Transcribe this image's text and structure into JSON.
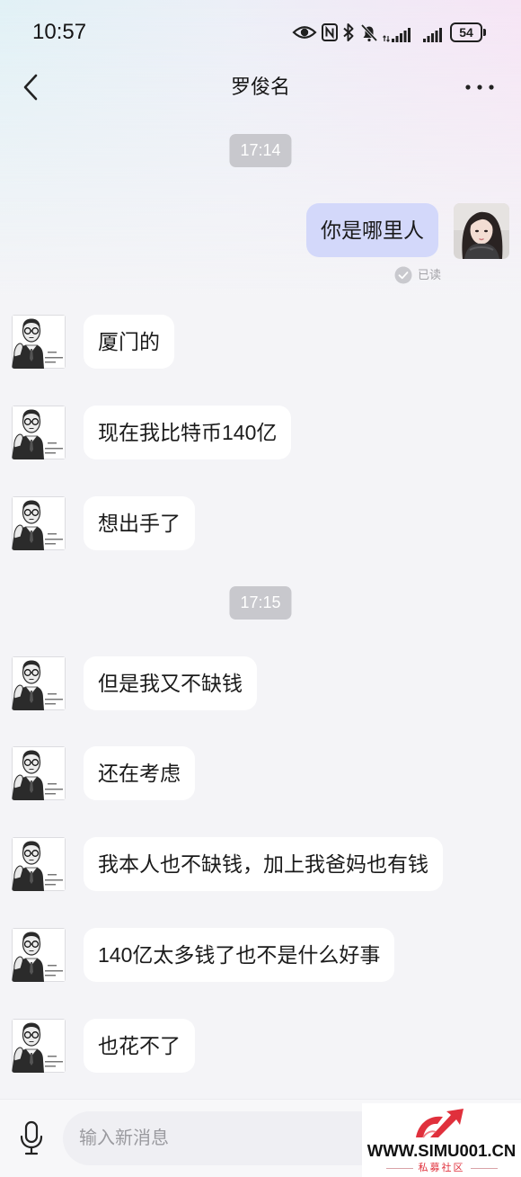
{
  "status_bar": {
    "time": "10:57",
    "battery": "54",
    "icons": [
      "eye-icon",
      "nfc-icon",
      "bluetooth-icon",
      "mute-bell-icon",
      "signal-icon",
      "signal-icon",
      "battery-icon"
    ]
  },
  "header": {
    "title": "罗俊名",
    "back_icon": "back-chevron-icon",
    "menu_icon": "more-dots-icon"
  },
  "time_dividers": [
    "17:14",
    "17:15"
  ],
  "messages": [
    {
      "text": "你是哪里人",
      "read_label": "已读"
    },
    {
      "text": "厦门的"
    },
    {
      "text": "现在我比特币140亿"
    },
    {
      "text": "想出手了"
    },
    {
      "text": "但是我又不缺钱"
    },
    {
      "text": "还在考虑"
    },
    {
      "text": "我本人也不缺钱，加上我爸妈也有钱"
    },
    {
      "text": "140亿太多钱了也不是什么好事"
    },
    {
      "text": "也花不了"
    }
  ],
  "input": {
    "placeholder": "输入新消息",
    "mic_icon": "microphone-icon"
  },
  "watermark": {
    "url": "WWW.SIMU001.CN",
    "label": "私募社区",
    "logo_icon": "simu-logo-icon"
  },
  "colors": {
    "outgoing_bubble": "#d3d8fa",
    "incoming_bubble": "#ffffff",
    "time_pill": "#c8c8cd",
    "page_background": "#f4f4f7",
    "brand_red": "#e0303c"
  }
}
